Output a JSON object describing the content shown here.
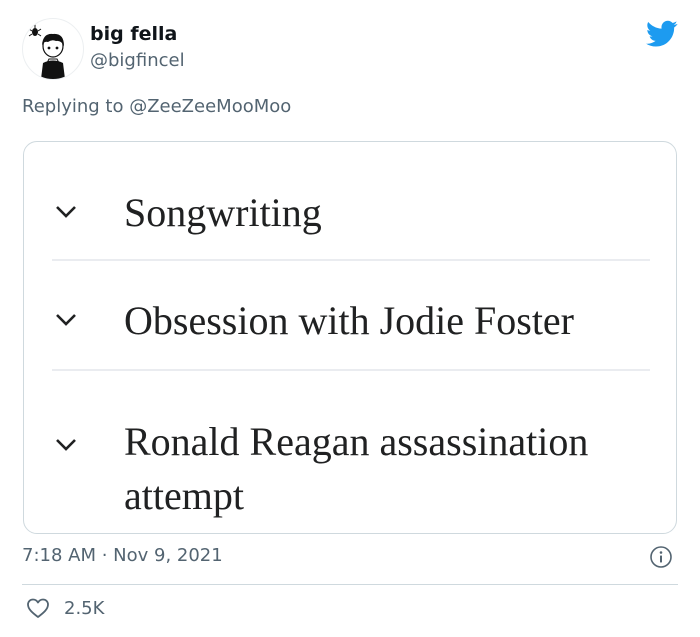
{
  "user": {
    "display_name": "big fella",
    "handle": "@bigfincel"
  },
  "reply_context": {
    "prefix": "Replying to ",
    "mention": "@ZeeZeeMooMoo"
  },
  "media": {
    "sections": [
      {
        "label": "Songwriting",
        "icon": "chevron-down-icon"
      },
      {
        "label": "Obsession with Jodie Foster",
        "icon": "chevron-down-icon"
      },
      {
        "label": "Ronald Reagan assassination attempt",
        "icon": "chevron-down-icon"
      }
    ]
  },
  "footer": {
    "timestamp": "7:18 AM · Nov 9, 2021",
    "likes_count": "2.5K"
  },
  "colors": {
    "twitter_blue": "#1d9bf0",
    "secondary_text": "#536471",
    "border": "#cfd9de"
  }
}
